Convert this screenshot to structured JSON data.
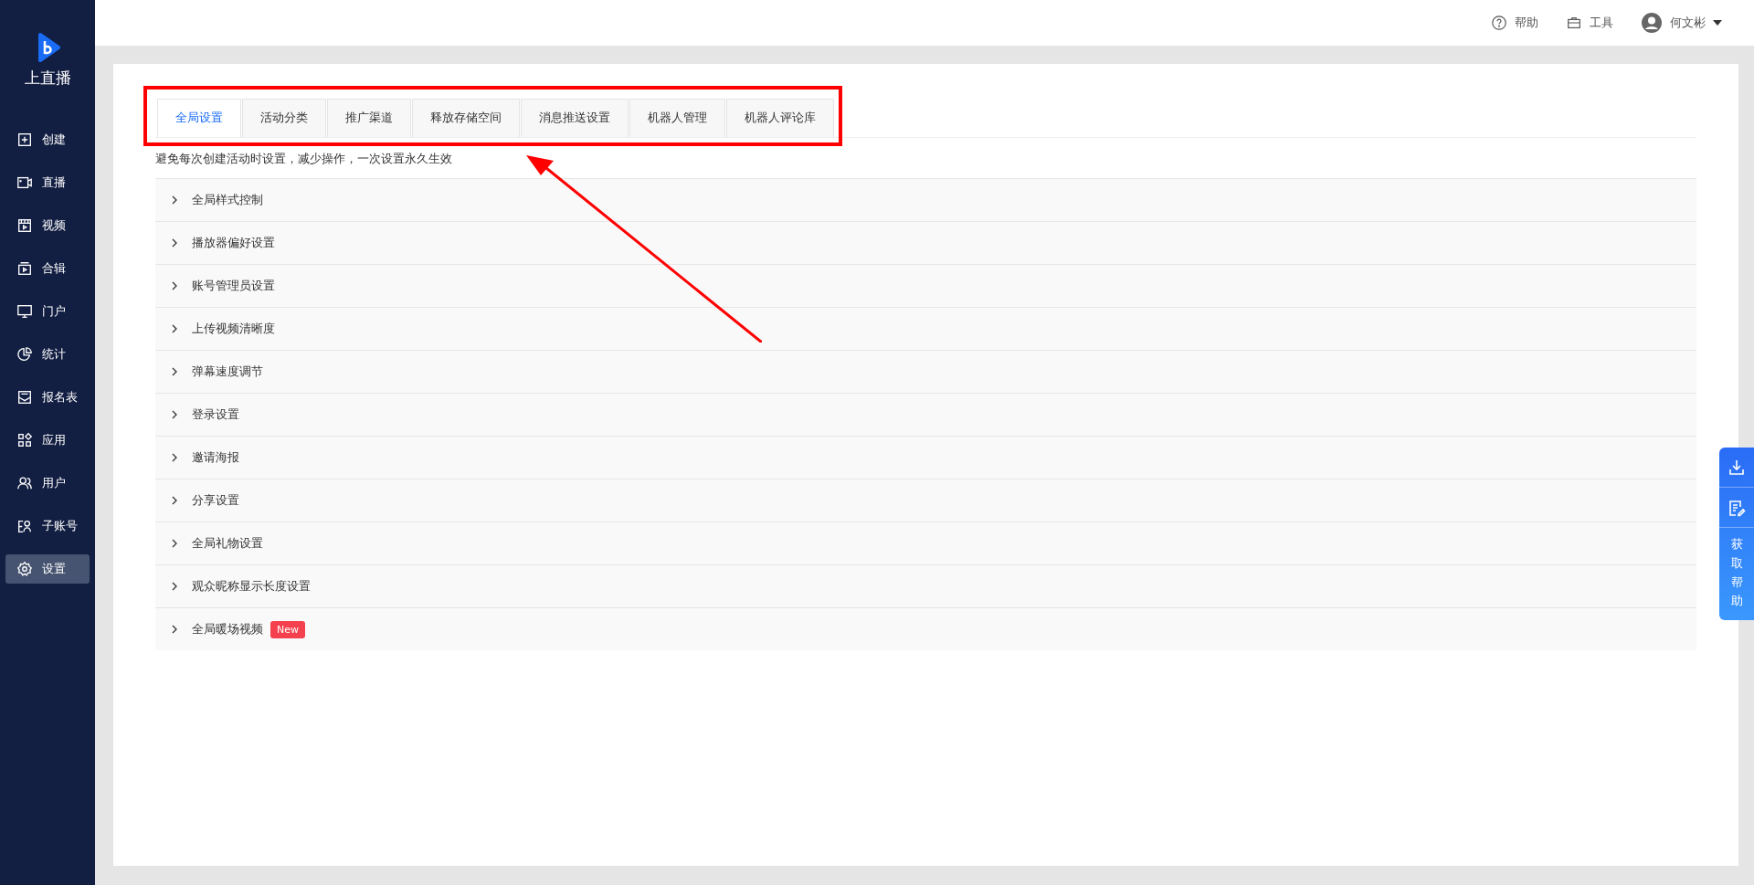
{
  "sidebar": {
    "logo_text": "上直播",
    "items": [
      {
        "label": "创建",
        "selected": false
      },
      {
        "label": "直播",
        "selected": false
      },
      {
        "label": "视频",
        "selected": false
      },
      {
        "label": "合辑",
        "selected": false
      },
      {
        "label": "门户",
        "selected": false
      },
      {
        "label": "统计",
        "selected": false
      },
      {
        "label": "报名表",
        "selected": false
      },
      {
        "label": "应用",
        "selected": false
      },
      {
        "label": "用户",
        "selected": false
      },
      {
        "label": "子账号",
        "selected": false
      },
      {
        "label": "设置",
        "selected": true
      }
    ]
  },
  "header": {
    "help": "帮助",
    "tools": "工具",
    "user": "何文彬"
  },
  "tabs": [
    {
      "label": "全局设置",
      "selected": true
    },
    {
      "label": "活动分类",
      "selected": false
    },
    {
      "label": "推广渠道",
      "selected": false
    },
    {
      "label": "释放存储空间",
      "selected": false
    },
    {
      "label": "消息推送设置",
      "selected": false
    },
    {
      "label": "机器人管理",
      "selected": false
    },
    {
      "label": "机器人评论库",
      "selected": false
    }
  ],
  "description": "避免每次创建活动时设置，减少操作，一次设置永久生效",
  "sections": [
    {
      "title": "全局样式控制",
      "expanded": false
    },
    {
      "title": "播放器偏好设置",
      "expanded": false
    },
    {
      "title": "账号管理员设置",
      "expanded": false
    },
    {
      "title": "上传视频清晰度",
      "expanded": false
    },
    {
      "title": "弹幕速度调节",
      "expanded": false
    },
    {
      "title": "登录设置",
      "expanded": false
    },
    {
      "title": "邀请海报",
      "expanded": false
    },
    {
      "title": "分享设置",
      "expanded": false
    },
    {
      "title": "全局礼物设置",
      "expanded": false
    },
    {
      "title": "观众昵称显示长度设置",
      "expanded": false
    },
    {
      "title": "全局暖场视频",
      "expanded": false,
      "badge": "New"
    }
  ],
  "float_panel": {
    "help_text": "获取帮助"
  }
}
